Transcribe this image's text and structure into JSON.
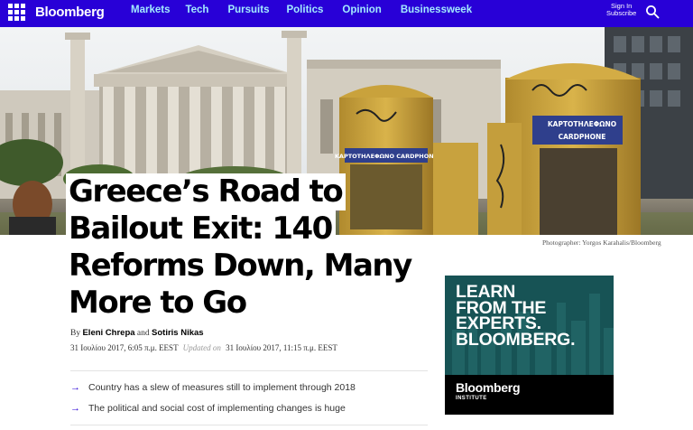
{
  "nav": {
    "brand": "Bloomberg",
    "links": [
      "Markets",
      "Tech",
      "Pursuits",
      "Politics",
      "Opinion",
      "Businessweek"
    ],
    "sign_in": "Sign In",
    "subscribe": "Subscribe",
    "brand_color": "#2800d7",
    "link_color": "#a3ebff"
  },
  "hero": {
    "kiosk_left_sign": "ΚΑΡΤΟΤΗΛΕΦΩΝΟ CARDPHONE",
    "kiosk_right_sign_top": "ΚΑΡΤΟΤΗΛΕΦΩΝΟ",
    "kiosk_right_sign_bottom": "CARDPHONE",
    "credit": "Photographer: Yorgos Karahalis/Bloomberg"
  },
  "article": {
    "headline_lines": [
      "Greece’s Road to",
      "Bailout Exit: 140",
      "Reforms Down, Many",
      "More to Go"
    ],
    "by": "By",
    "author1": "Eleni Chrepa",
    "and": "and",
    "author2": "Sotiris Nikas",
    "published": "31 Ιουλίου 2017, 6:05 π.μ. EEST",
    "updated_label": "Updated on",
    "updated": "31 Ιουλίου 2017, 11:15 π.μ. EEST",
    "bullets": [
      "Country has a slew of measures still to implement through 2018",
      "The political and social cost of implementing changes is huge"
    ]
  },
  "ad": {
    "lines": [
      "LEARN",
      "FROM THE",
      "EXPERTS.",
      "BLOOMBERG."
    ],
    "logo": "Bloomberg",
    "institute": "INSTITUTE"
  }
}
